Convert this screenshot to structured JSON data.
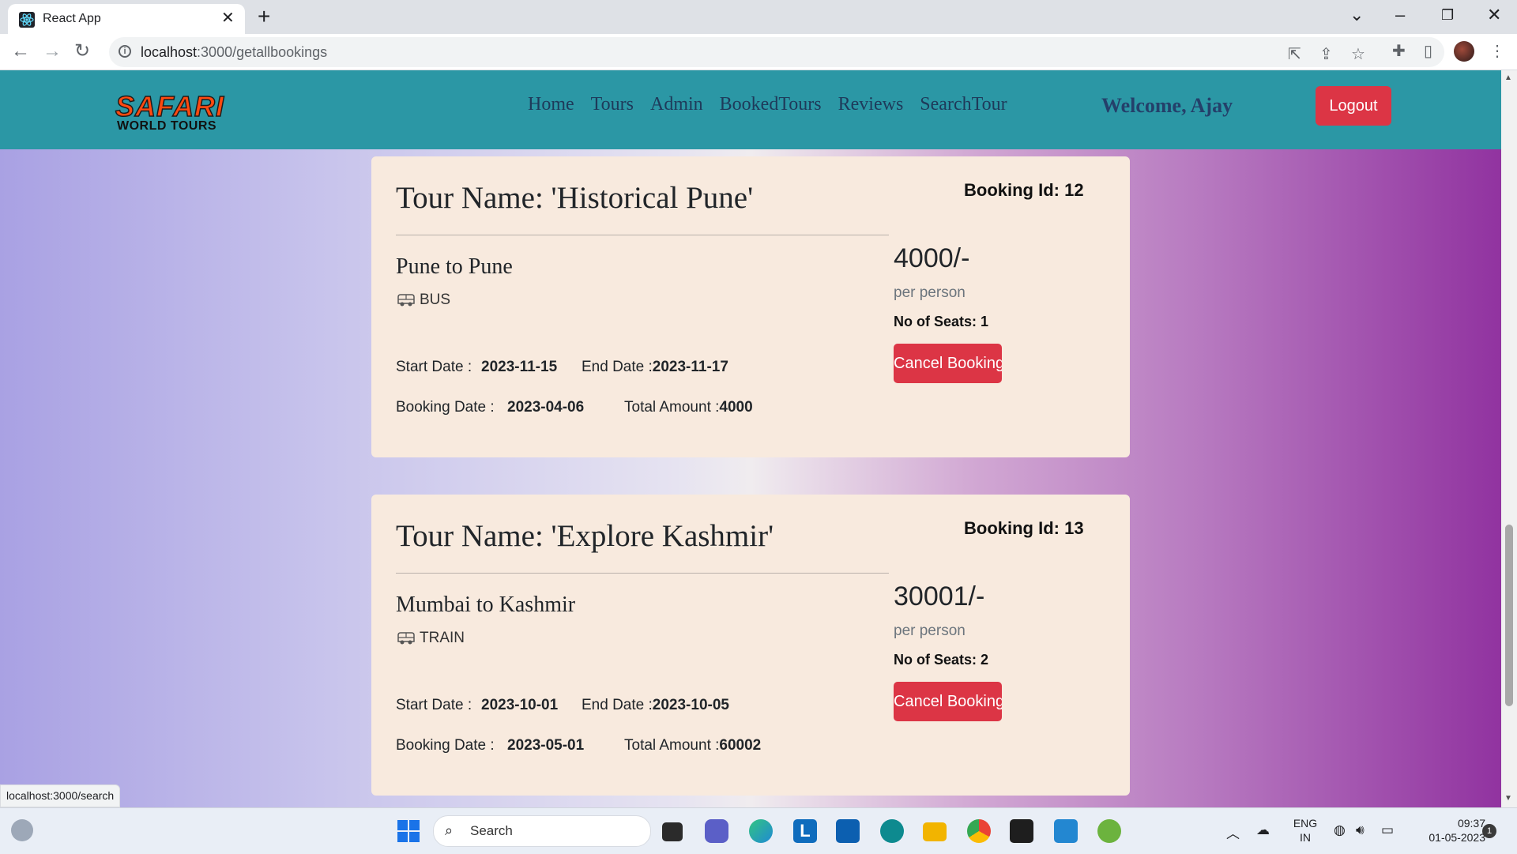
{
  "browser": {
    "tab_title": "React App",
    "url_host": "localhost",
    "url_path": ":3000/getallbookings",
    "status_url": "localhost:3000/search"
  },
  "navbar": {
    "logo_top": "SAFARI",
    "logo_bottom": "WORLD TOURS",
    "links": [
      "Home",
      "Tours",
      "Admin",
      "BookedTours",
      "Reviews",
      "SearchTour"
    ],
    "welcome": "Welcome, Ajay",
    "logout_label": "Logout",
    "bg_color": "#2b97a5"
  },
  "labels": {
    "start_date": "Start Date :",
    "end_date": "End Date :",
    "booking_date": "Booking Date :",
    "total_amount": "Total Amount :",
    "per_person": "per person",
    "cancel": "Cancel Booking"
  },
  "bookings": [
    {
      "tour_name": "Tour Name: 'Historical Pune'",
      "booking_id": "Booking Id: 12",
      "route": "Pune to Pune",
      "transport": "BUS",
      "start_date": "2023-11-15",
      "end_date": "2023-11-17",
      "booking_date": "2023-04-06",
      "total_amount": "4000",
      "price": "4000/-",
      "seats": "No of Seats: 1"
    },
    {
      "tour_name": "Tour Name: 'Explore Kashmir'",
      "booking_id": "Booking Id: 13",
      "route": "Mumbai to Kashmir",
      "transport": "TRAIN",
      "start_date": "2023-10-01",
      "end_date": "2023-10-05",
      "booking_date": "2023-05-01",
      "total_amount": "60002",
      "price": "30001/-",
      "seats": "No of Seats: 2"
    }
  ],
  "taskbar": {
    "search_label": "Search",
    "lang_top": "ENG",
    "lang_bottom": "IN",
    "time": "09:37",
    "date": "01-05-2023",
    "notification_count": "1"
  }
}
